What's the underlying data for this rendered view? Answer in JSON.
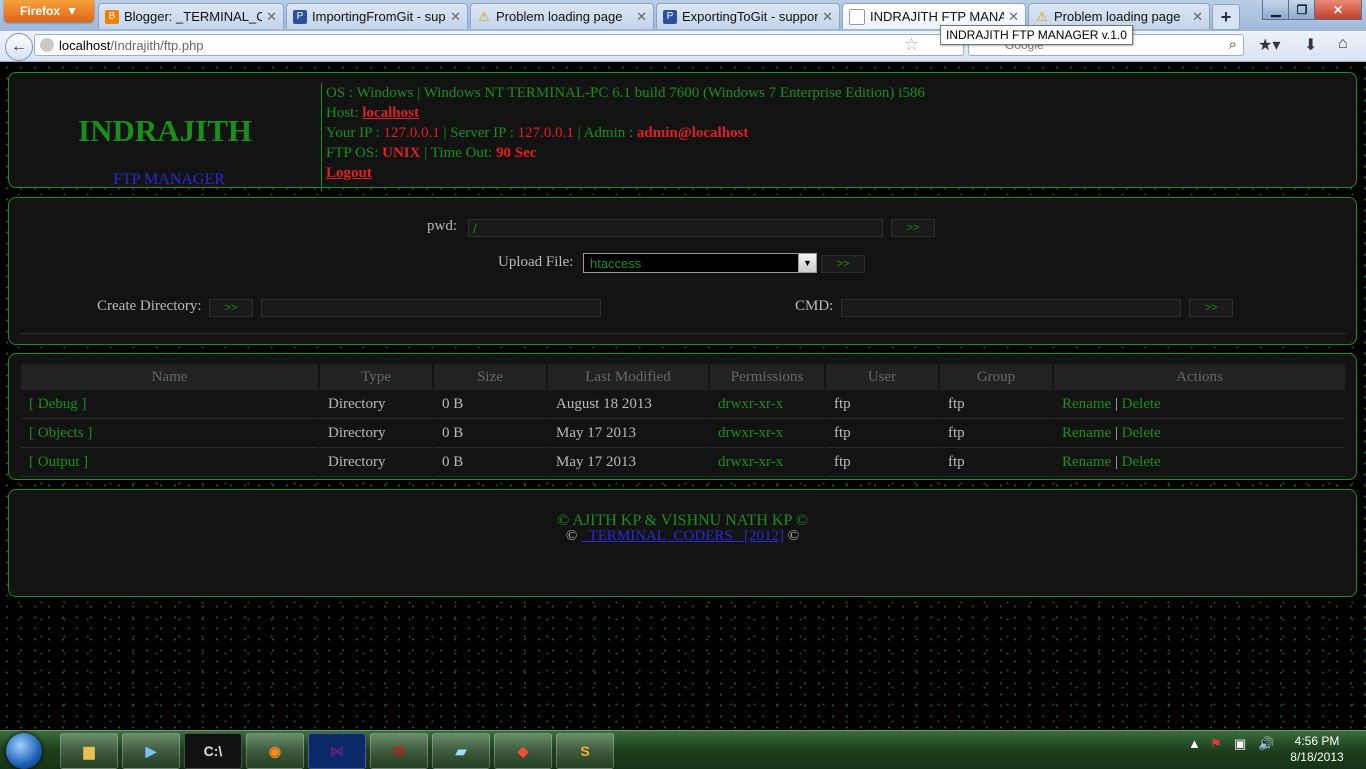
{
  "browser": {
    "menu_label": "Firefox",
    "tabs": [
      {
        "title": "Blogger: _TERMINAL_CO...",
        "icon": "blogger-icon"
      },
      {
        "title": "ImportingFromGit - supp...",
        "icon": "pj-icon"
      },
      {
        "title": "Problem loading page",
        "icon": "warning-icon"
      },
      {
        "title": "ExportingToGit - support...",
        "icon": "pj-icon"
      },
      {
        "title": "INDRAJITH FTP MANAG...",
        "icon": "blank-page-icon"
      },
      {
        "title": "Problem loading page",
        "icon": "warning-icon"
      }
    ],
    "url_host": "localhost",
    "url_path": "/Indrajith/ftp.php",
    "search_text": "Google",
    "tooltip": "INDRAJITH FTP MANAGER v.1.0"
  },
  "brand": {
    "title": "INDRAJITH",
    "subtitle": "FTP MANAGER"
  },
  "info": {
    "os_label": "OS : Windows | Windows NT TERMINAL-PC 6.1 build 7600 (Windows 7 Enterprise Edition) i586",
    "host_label": "Host: ",
    "host_value": "localhost",
    "your_ip_label": "Your IP : ",
    "your_ip_value": "127.0.0.1",
    "server_ip_label": " | Server IP : ",
    "server_ip_value": "127.0.0.1",
    "admin_label": " | Admin : ",
    "admin_value": "admin@localhost",
    "ftp_os_label": "FTP OS: ",
    "ftp_os_value": "UNIX",
    "timeout_label": " | Time Out: ",
    "timeout_value": "90 Sec",
    "logout": "Logout"
  },
  "controls": {
    "pwd_label": "pwd:",
    "pwd_value": "/",
    "go_label": ">>",
    "upload_label": "Upload File:",
    "upload_selected": "htaccess",
    "create_dir_label": "Create Directory:",
    "cmd_label": "CMD:"
  },
  "table": {
    "headers": [
      "Name",
      "Type",
      "Size",
      "Last Modified",
      "Permissions",
      "User",
      "Group",
      "Actions"
    ],
    "rows": [
      {
        "name": "[ Debug ]",
        "type": "Directory",
        "size": "0 B",
        "modified": "August 18 2013",
        "perms": "drwxr-xr-x",
        "user": "ftp",
        "group": "ftp"
      },
      {
        "name": "[ Objects ]",
        "type": "Directory",
        "size": "0 B",
        "modified": "May 17 2013",
        "perms": "drwxr-xr-x",
        "user": "ftp",
        "group": "ftp"
      },
      {
        "name": "[ Output ]",
        "type": "Directory",
        "size": "0 B",
        "modified": "May 17 2013",
        "perms": "drwxr-xr-x",
        "user": "ftp",
        "group": "ftp"
      }
    ],
    "rename_label": "Rename",
    "delete_label": "Delete",
    "action_sep": "|"
  },
  "footer": {
    "line1": "© AJITH KP & VISHNU NATH KP ©",
    "copy_symbol": "©",
    "link_text": "_TERMINAL_CODERS_ [2012]"
  },
  "taskbar": {
    "time": "4:56 PM",
    "date": "8/18/2013"
  },
  "colors": {
    "accent_green": "#1a8f1a",
    "value_red": "#e02020",
    "link_blue": "#2a2ad0"
  }
}
